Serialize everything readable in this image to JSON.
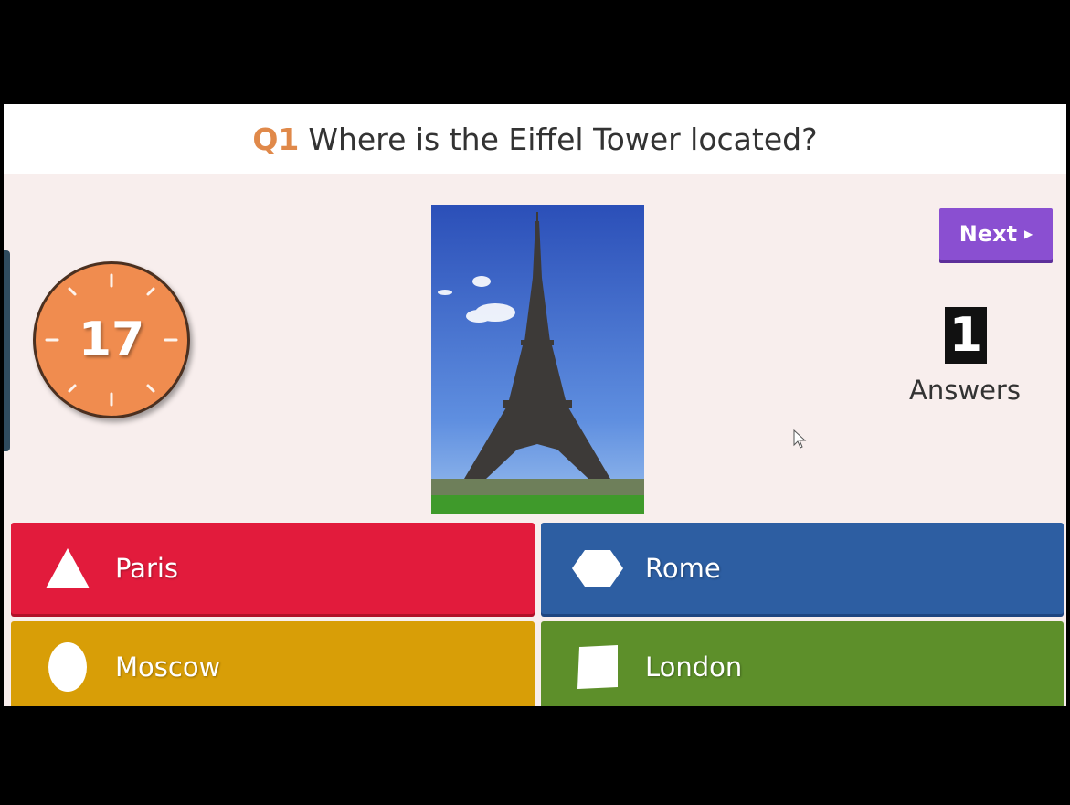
{
  "question": {
    "number": "Q1",
    "text": "Where is the Eiffel Tower located?"
  },
  "timer": {
    "value": "17"
  },
  "image": {
    "subject": "eiffel-tower-photo"
  },
  "next_button": {
    "label": "Next",
    "icon": "caret-right-icon"
  },
  "answers_count": {
    "value": "1",
    "label": "Answers"
  },
  "answers": [
    {
      "label": "Paris",
      "shape": "triangle-icon",
      "color": "#e21b3c"
    },
    {
      "label": "Rome",
      "shape": "hexagon-icon",
      "color": "#2d5ea2"
    },
    {
      "label": "Moscow",
      "shape": "circle-icon",
      "color": "#d89e07"
    },
    {
      "label": "London",
      "shape": "square-icon",
      "color": "#5d8f2a"
    }
  ],
  "colors": {
    "question_number": "#e0894a",
    "timer": "#f08c4f",
    "next_button": "#8a4fd1",
    "stage_bg": "#f8eeed"
  }
}
